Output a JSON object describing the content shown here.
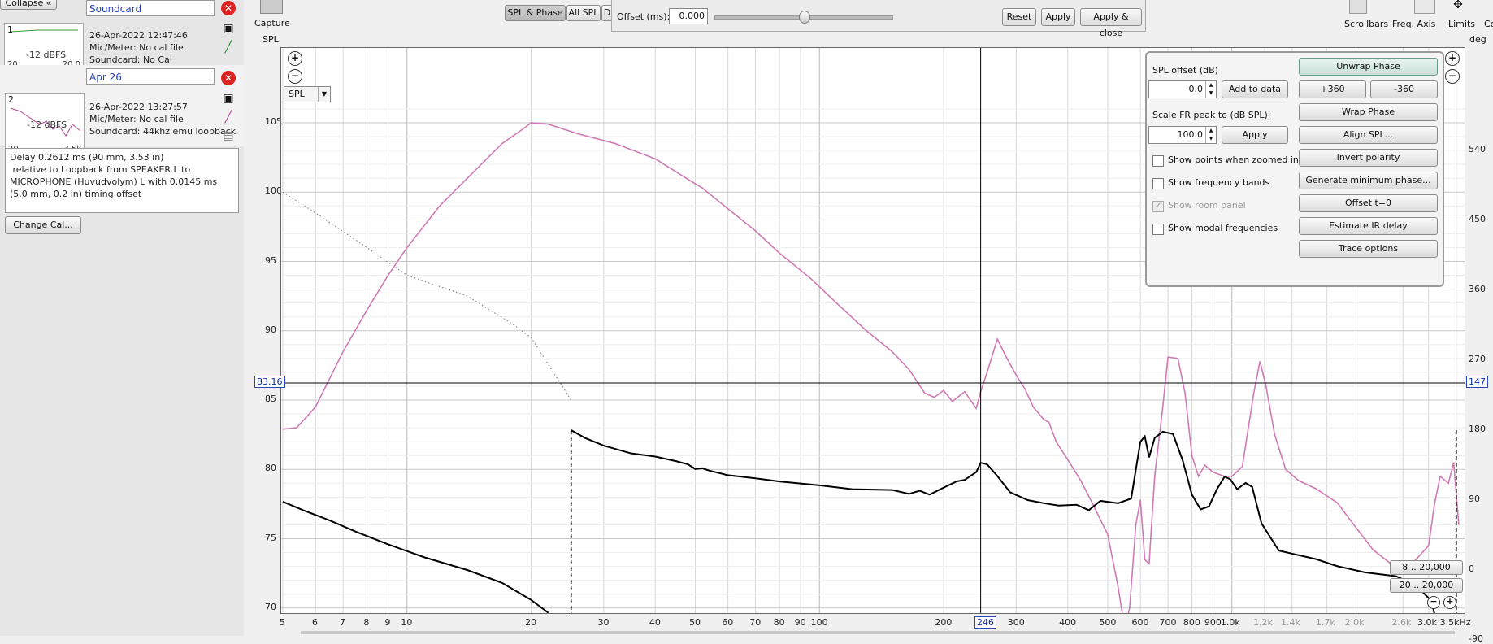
{
  "left": {
    "collapse_label": "Collapse",
    "measurements": [
      {
        "name": "Soundcard",
        "thumb_num": "1",
        "thumb_level": "-12 dBFS",
        "thumb_freq_left": "20",
        "thumb_freq_right": "20.0",
        "date": "26-Apr-2022 12:47:46",
        "mic": "Mic/Meter: No cal file",
        "soundcard": "Soundcard: No Cal"
      },
      {
        "name": "Apr 26",
        "thumb_num": "2",
        "thumb_level": "-12 dBFS",
        "thumb_freq_left": "20",
        "thumb_freq_right": "3.5k",
        "date": "26-Apr-2022 13:27:57",
        "mic": "Mic/Meter: No cal file",
        "soundcard": "Soundcard: 44khz emu loopback"
      }
    ],
    "delay_text": "Delay 0.2612 ms (90 mm, 3.53 in)\n relative to Loopback from SPEAKER L to MICROPHONE (Huvudvolym) L with 0.0145 ms (5.0 mm, 0.2 in) timing offset",
    "change_cal_label": "Change Cal..."
  },
  "toolbar": {
    "capture_label": "Capture",
    "tabs": [
      "SPL & Phase",
      "All SPL",
      "D"
    ],
    "offset_label": "Offset (ms):",
    "offset_value": "0.000",
    "offset_slider_fraction": 0.5,
    "reset_label": "Reset",
    "apply_label": "Apply",
    "apply_close_label": "Apply & close",
    "scrollbars_label": "Scrollbars",
    "freq_axis_label": "Freq. Axis",
    "limits_label": "Limits",
    "cut_label": "Co"
  },
  "plot": {
    "y_left_title": "SPL",
    "y_right_title": "deg",
    "y_left_ticks": [
      "105",
      "100",
      "95",
      "90",
      "85",
      "80",
      "75",
      "70"
    ],
    "y_right_ticks": [
      "540",
      "450",
      "360",
      "270",
      "180",
      "90",
      "0",
      "-90"
    ],
    "x_ticks": [
      "5",
      "6",
      "7",
      "8",
      "9",
      "10",
      "20",
      "30",
      "40",
      "50",
      "60",
      "70",
      "80",
      "90",
      "100",
      "200",
      "300",
      "400",
      "500",
      "600",
      "700",
      "800",
      "900",
      "1.0k",
      "1.2k",
      "1.4k",
      "1.7k",
      "2.0k",
      "2.6k",
      "3.0k",
      "3.5kHz"
    ],
    "cursor_spl": "83.16",
    "cursor_deg": "147",
    "cursor_freq": "246",
    "spl_select": "SPL",
    "range_btn_1": "8 .. 20,000",
    "range_btn_2": "20 .. 20,000",
    "colors": {
      "spl_trace": "#d07ab5",
      "phase_trace": "#000000",
      "grid": "#d8d8d8"
    }
  },
  "controls": {
    "spl_offset_label": "SPL offset (dB)",
    "spl_offset_value": "0.0",
    "add_to_data_label": "Add to data",
    "scale_label": "Scale FR peak to (dB SPL):",
    "scale_value": "100.0",
    "apply_label": "Apply",
    "checkboxes": [
      {
        "label": "Show points when zoomed in",
        "checked": false,
        "enabled": true
      },
      {
        "label": "Show frequency bands",
        "checked": false,
        "enabled": true
      },
      {
        "label": "Show room panel",
        "checked": true,
        "enabled": false
      },
      {
        "label": "Show modal frequencies",
        "checked": false,
        "enabled": true
      }
    ],
    "unwrap_label": "Unwrap Phase",
    "plus360_label": "+360",
    "minus360_label": "-360",
    "wrap_label": "Wrap Phase",
    "align_label": "Align SPL...",
    "invert_label": "Invert polarity",
    "genmin_label": "Generate minimum phase...",
    "offset_t0_label": "Offset t=0",
    "estimate_label": "Estimate IR delay",
    "trace_label": "Trace options"
  }
}
